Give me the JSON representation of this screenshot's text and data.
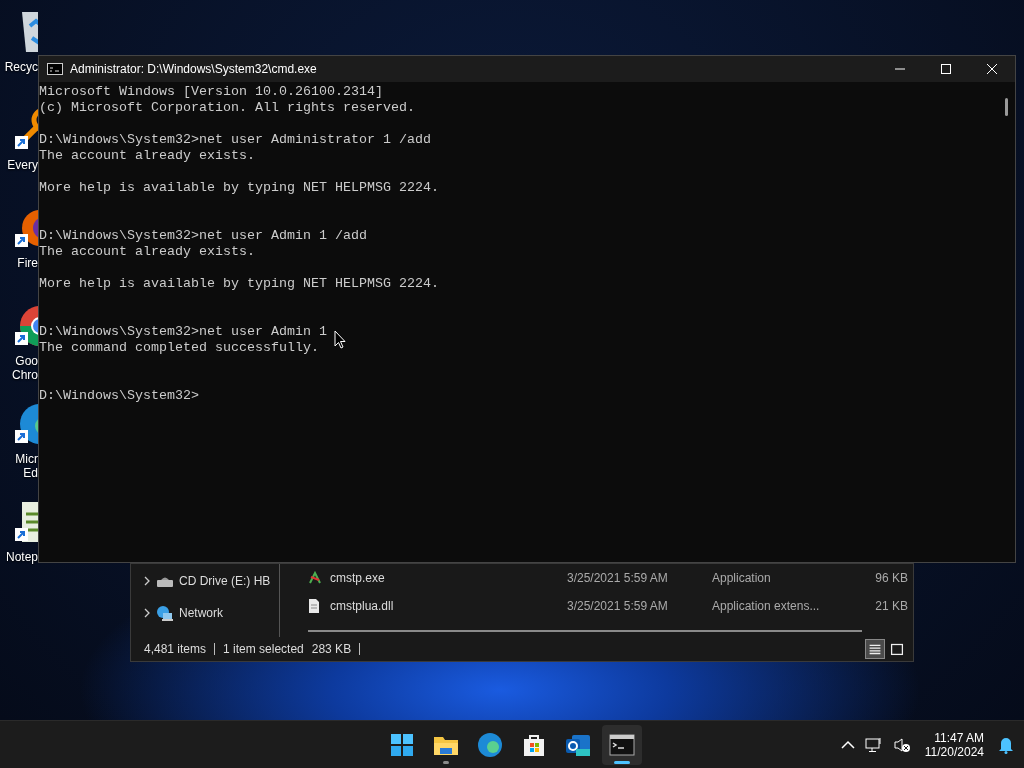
{
  "desktop_icons": [
    {
      "kind": "bin",
      "shortcut": false,
      "label_lines": [
        "Recyc"
      ]
    },
    {
      "kind": "magnifier",
      "shortcut": true,
      "label_lines": [
        "Every"
      ]
    },
    {
      "kind": "fox",
      "shortcut": true,
      "label_lines": [
        "Fire"
      ]
    },
    {
      "kind": "chrome",
      "shortcut": true,
      "label_lines": [
        "Goo",
        "Chro"
      ]
    },
    {
      "kind": "edge",
      "shortcut": true,
      "label_lines": [
        "Micr",
        "Ed"
      ]
    },
    {
      "kind": "notepad",
      "shortcut": true,
      "label_lines": [
        "Notep"
      ]
    }
  ],
  "explorer_window": {
    "nav_items": [
      {
        "kind": "drive",
        "label": "CD Drive (E:) HB"
      },
      {
        "kind": "network",
        "label": "Network"
      }
    ],
    "files": [
      {
        "kind": "exe",
        "name": "cmstp.exe",
        "date": "3/25/2021 5:59 AM",
        "type": "Application",
        "size": "96 KB"
      },
      {
        "kind": "dll",
        "name": "cmstplua.dll",
        "date": "3/25/2021 5:59 AM",
        "type": "Application extens...",
        "size": "21 KB"
      }
    ],
    "status": {
      "item_count": "4,481 items",
      "selection": "1 item selected",
      "selection_size": "283 KB"
    },
    "view_buttons": [
      {
        "kind": "details",
        "selected": true
      },
      {
        "kind": "tiles",
        "selected": false
      }
    ]
  },
  "console_window": {
    "title": "Administrator: D:\\Windows\\System32\\cmd.exe",
    "lines": [
      {
        "kind": "text",
        "text": "Microsoft Windows [Version 10.0.26100.2314]"
      },
      {
        "kind": "text",
        "text": "(c) Microsoft Corporation. All rights reserved."
      },
      {
        "kind": "blank"
      },
      {
        "kind": "text",
        "text": "D:\\Windows\\System32>net user Administrator 1 /add"
      },
      {
        "kind": "text",
        "text": "The account already exists."
      },
      {
        "kind": "blank"
      },
      {
        "kind": "text",
        "text": "More help is available by typing NET HELPMSG 2224."
      },
      {
        "kind": "blank"
      },
      {
        "kind": "blank"
      },
      {
        "kind": "text",
        "text": "D:\\Windows\\System32>net user Admin 1 /add"
      },
      {
        "kind": "text",
        "text": "The account already exists."
      },
      {
        "kind": "blank"
      },
      {
        "kind": "text",
        "text": "More help is available by typing NET HELPMSG 2224."
      },
      {
        "kind": "blank"
      },
      {
        "kind": "blank"
      },
      {
        "kind": "text",
        "text": "D:\\Windows\\System32>net user Admin 1"
      },
      {
        "kind": "text",
        "text": "The command completed successfully."
      },
      {
        "kind": "blank"
      },
      {
        "kind": "blank"
      },
      {
        "kind": "text",
        "text": "D:\\Windows\\System32>"
      }
    ]
  },
  "taskbar": {
    "apps": [
      {
        "kind": "start",
        "running": false,
        "selected": false
      },
      {
        "kind": "folder",
        "running": true,
        "selected": false
      },
      {
        "kind": "edge",
        "running": false,
        "selected": false
      },
      {
        "kind": "store",
        "running": false,
        "selected": false
      },
      {
        "kind": "mail",
        "running": false,
        "selected": false
      },
      {
        "kind": "terminal",
        "running": true,
        "selected": true
      }
    ],
    "time": "11:47 AM",
    "date": "11/20/2024"
  }
}
